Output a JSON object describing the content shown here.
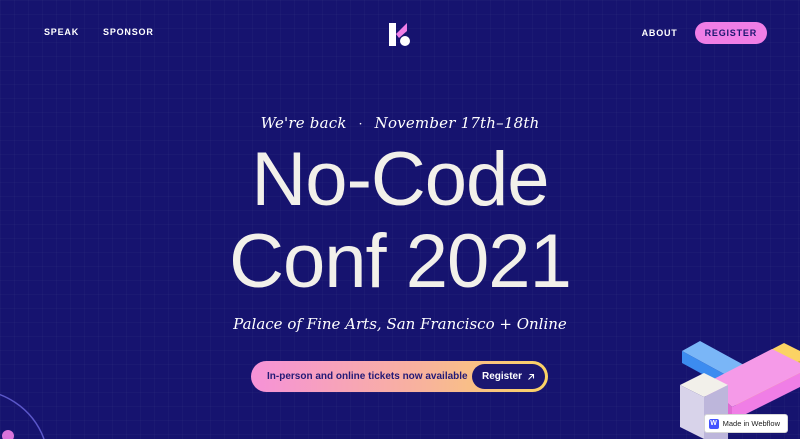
{
  "nav": {
    "left": [
      {
        "label": "SPEAK"
      },
      {
        "label": "SPONSOR"
      }
    ],
    "about": "ABOUT",
    "register": "REGISTER",
    "logo_icon": "kf-logo-icon"
  },
  "hero": {
    "eyebrow_left": "We're back",
    "eyebrow_sep": "·",
    "eyebrow_right": "November 17th–18th",
    "title_line1": "No-Code",
    "title_line2": "Conf 2021",
    "venue": "Palace of Fine Arts, San Francisco + Online"
  },
  "cta": {
    "text": "In-person and online tickets now available",
    "button_label": "Register",
    "button_icon": "arrow-up-right-icon"
  },
  "badge": {
    "icon_letter": "W",
    "label": "Made in Webflow"
  },
  "colors": {
    "background": "#16136f",
    "accent_pink": "#f07ee6",
    "accent_yellow": "#fbd364",
    "accent_blue": "#3c8cf0"
  }
}
